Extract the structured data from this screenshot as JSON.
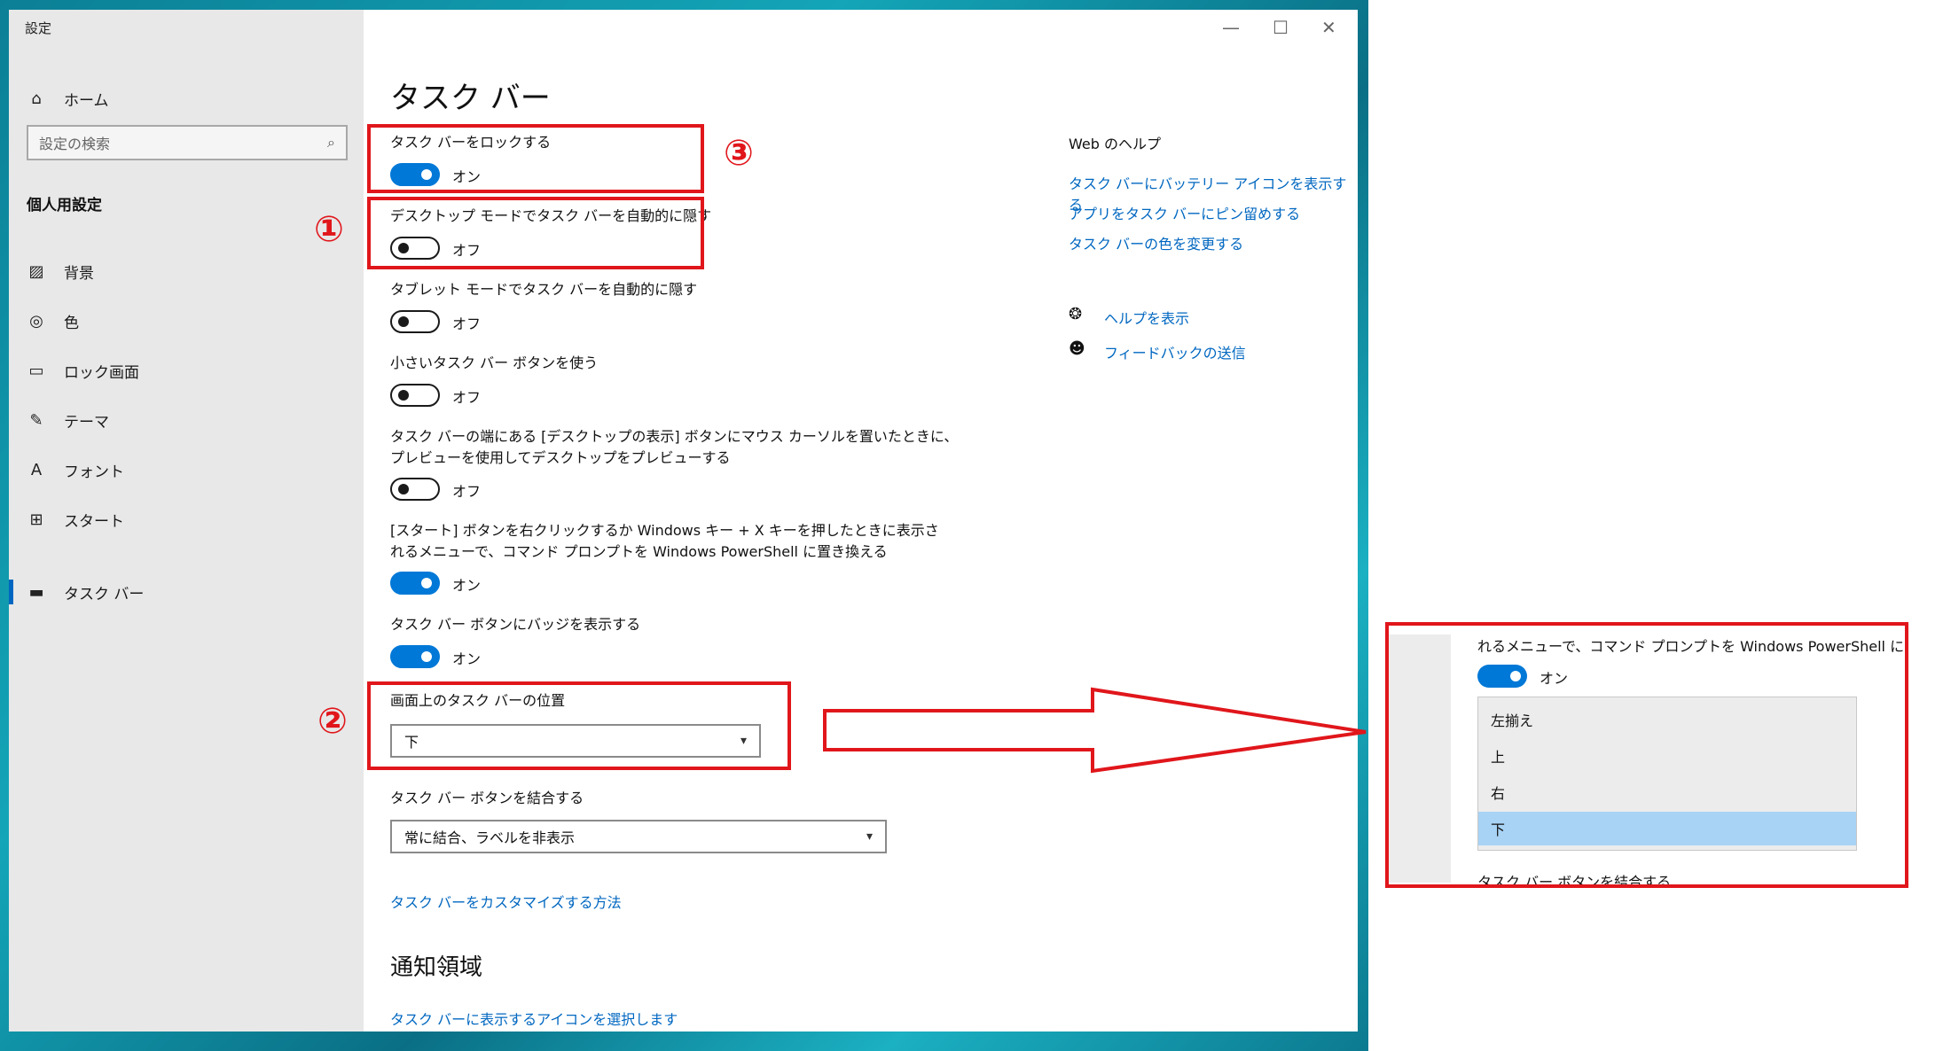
{
  "window": {
    "title": "設定",
    "controls": {
      "minimize": "—",
      "maximize": "☐",
      "close": "✕"
    }
  },
  "sidebar": {
    "home": "ホーム",
    "search_placeholder": "設定の検索",
    "section": "個人用設定",
    "items": [
      {
        "label": "背景",
        "icon": "image-icon"
      },
      {
        "label": "色",
        "icon": "palette-icon"
      },
      {
        "label": "ロック画面",
        "icon": "lock-screen-icon"
      },
      {
        "label": "テーマ",
        "icon": "theme-icon"
      },
      {
        "label": "フォント",
        "icon": "font-icon"
      },
      {
        "label": "スタート",
        "icon": "start-icon"
      },
      {
        "label": "タスク バー",
        "icon": "taskbar-icon",
        "active": true
      }
    ]
  },
  "main": {
    "title": "タスク バー",
    "settings": [
      {
        "label": "タスク バーをロックする",
        "state": "オン",
        "on": true
      },
      {
        "label": "デスクトップ モードでタスク バーを自動的に隠す",
        "state": "オフ",
        "on": false
      },
      {
        "label": "タブレット モードでタスク バーを自動的に隠す",
        "state": "オフ",
        "on": false
      },
      {
        "label": "小さいタスク バー ボタンを使う",
        "state": "オフ",
        "on": false
      },
      {
        "label_line1": "タスク バーの端にある [デスクトップの表示] ボタンにマウス カーソルを置いたときに、",
        "label_line2": "プレビューを使用してデスクトップをプレビューする",
        "state": "オフ",
        "on": false
      },
      {
        "label_line1": "[スタート] ボタンを右クリックするか Windows キー + X キーを押したときに表示さ",
        "label_line2": "れるメニューで、コマンド プロンプトを Windows PowerShell に置き換える",
        "state": "オン",
        "on": true
      },
      {
        "label": "タスク バー ボタンにバッジを表示する",
        "state": "オン",
        "on": true
      }
    ],
    "position": {
      "label": "画面上のタスク バーの位置",
      "value": "下"
    },
    "combine": {
      "label": "タスク バー ボタンを結合する",
      "value": "常に結合、ラベルを非表示"
    },
    "customize_link": "タスク バーをカスタマイズする方法",
    "notification_heading": "通知領域",
    "notification_link": "タスク バーに表示するアイコンを選択します"
  },
  "help": {
    "heading": "Web のヘルプ",
    "links": [
      "タスク バーにバッテリー アイコンを表示する",
      "アプリをタスク バーにピン留めする",
      "タスク バーの色を変更する"
    ],
    "get_help": "ヘルプを表示",
    "feedback": "フィードバックの送信"
  },
  "annotations": {
    "n1": "①",
    "n2": "②",
    "n3": "③",
    "color": "#e0161b"
  },
  "inset": {
    "line": "れるメニューで、コマンド プロンプトを Windows PowerShell に置き換え",
    "state": "オン",
    "options": [
      "左揃え",
      "上",
      "右",
      "下"
    ],
    "selected": "下",
    "cut_text": "タスク バー ボタンを結合する"
  },
  "colors": {
    "accent": "#0078d7",
    "link": "#0067c0",
    "sidebar": "#e8e8e8",
    "annotation": "#e0161b",
    "selected_option": "#a8d3f5"
  }
}
